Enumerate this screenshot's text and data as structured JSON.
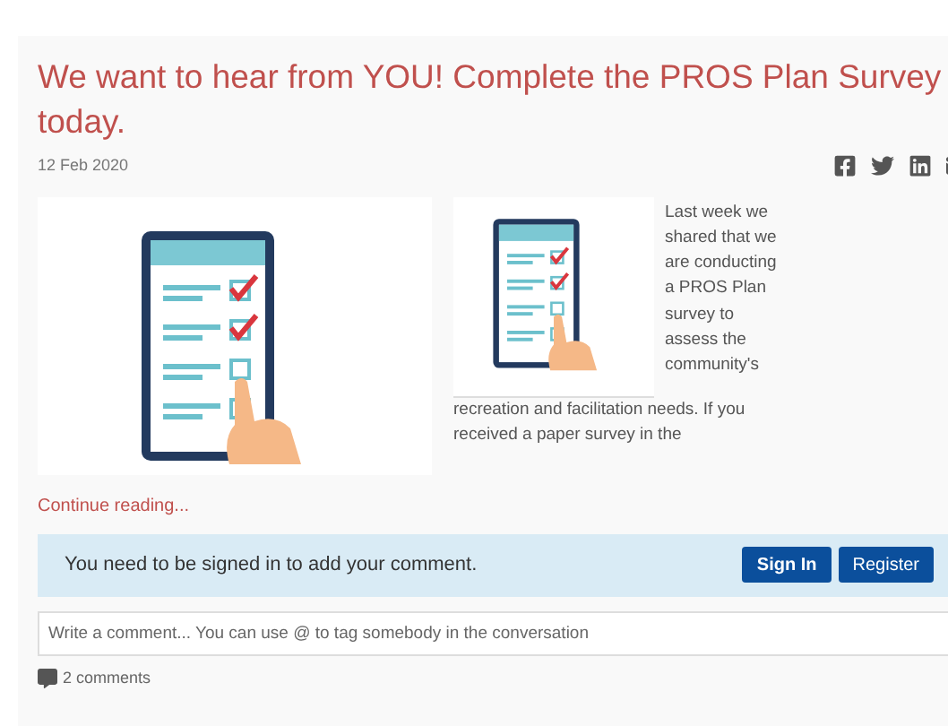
{
  "post": {
    "title": "We want to hear from YOU! Complete the PROS Plan Survey today.",
    "date": "12 Feb 2020",
    "body_beside_image": "Last week we shared that we are conducting a PROS Plan survey to assess the community's",
    "body_below_image": "recreation and facilitation needs. If you received a paper survey in the",
    "continue_link": "Continue reading..."
  },
  "comment_notice": {
    "message": "You need to be signed in to add your comment.",
    "buttons": [
      {
        "label": "Sign In",
        "kind": "primary"
      },
      {
        "label": "Register",
        "kind": "secondary"
      }
    ]
  },
  "comment_field": {
    "placeholder": "Write a comment... You can use @ to tag somebody in the conversation"
  },
  "comment_count": "2 comments"
}
